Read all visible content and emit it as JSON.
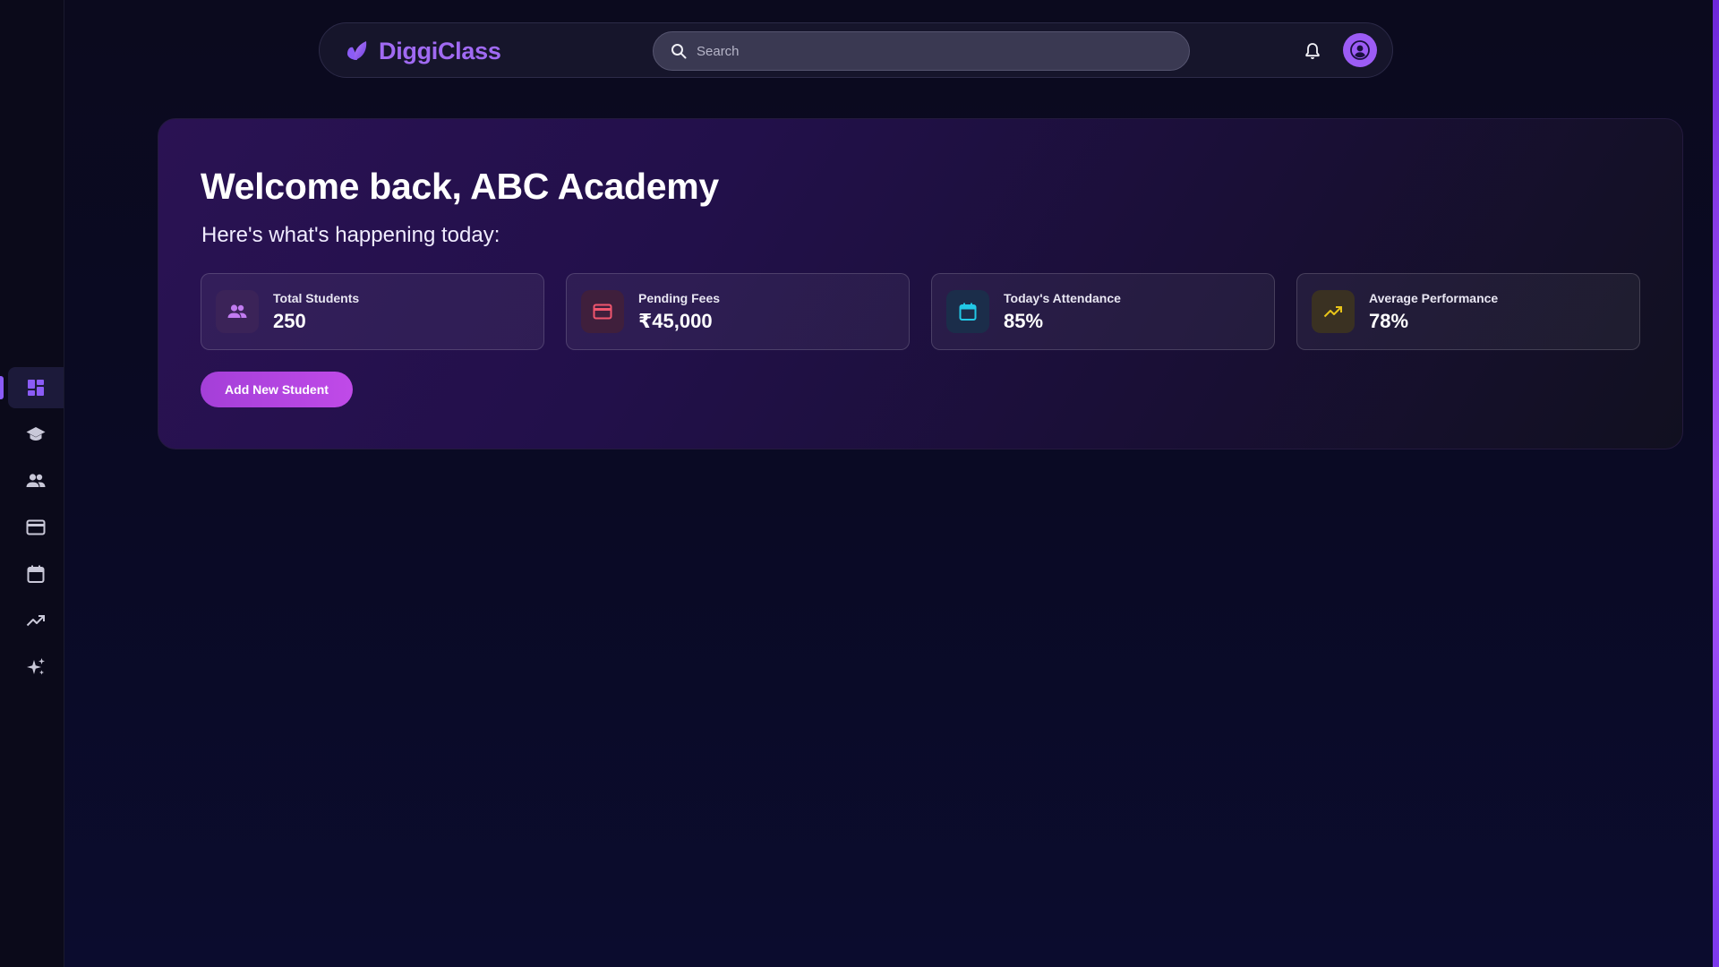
{
  "app": {
    "brand_name": "DiggiClass"
  },
  "search": {
    "placeholder": "Search"
  },
  "hero": {
    "title": "Welcome back, ABC Academy",
    "subtitle": "Here's what's happening today:",
    "add_button": "Add New Student"
  },
  "stats": [
    {
      "label": "Total Students",
      "value": "250",
      "icon": "people-icon",
      "accent": "#c17bf0"
    },
    {
      "label": "Pending Fees",
      "value": "₹45,000",
      "icon": "credit-card-icon",
      "accent": "#f0566e"
    },
    {
      "label": "Today's Attendance",
      "value": "85%",
      "icon": "calendar-icon",
      "accent": "#22c8e6"
    },
    {
      "label": "Average Performance",
      "value": "78%",
      "icon": "trending-up-icon",
      "accent": "#e8c419"
    }
  ],
  "sidebar": {
    "items": [
      {
        "icon": "dashboard-icon",
        "active": true
      },
      {
        "icon": "graduation-cap-icon",
        "active": false
      },
      {
        "icon": "people-icon",
        "active": false
      },
      {
        "icon": "credit-card-icon",
        "active": false
      },
      {
        "icon": "calendar-icon",
        "active": false
      },
      {
        "icon": "trending-up-icon",
        "active": false
      },
      {
        "icon": "sparkles-icon",
        "active": false
      }
    ]
  },
  "colors": {
    "accent": "#8b5cf6",
    "brand": "#a06af2",
    "button": "#b145e0",
    "background": "#0b0a24"
  }
}
